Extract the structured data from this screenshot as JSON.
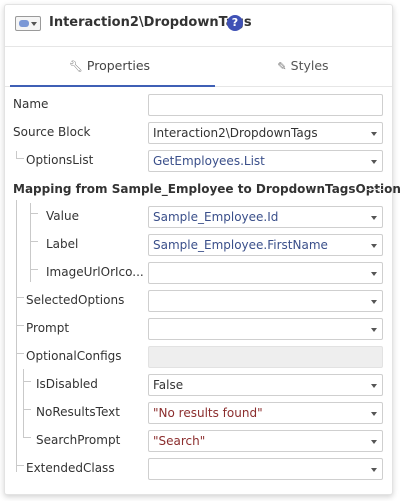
{
  "header": {
    "title": "Interaction2\\DropdownTags",
    "help_label": "?"
  },
  "tabs": [
    {
      "label": "Properties",
      "icon": "wrench-icon",
      "active": true
    },
    {
      "label": "Styles",
      "icon": "brush-icon",
      "active": false
    }
  ],
  "rows": {
    "name": {
      "label": "Name",
      "value": ""
    },
    "source_block": {
      "label": "Source Block",
      "value": "Interaction2\\DropdownTags"
    },
    "options_list": {
      "label": "OptionsList",
      "value": "GetEmployees.List"
    },
    "mapping_title": "Mapping from Sample_Employee to DropdownTagsOption",
    "value": {
      "label": "Value",
      "value": "Sample_Employee.Id"
    },
    "label": {
      "label": "Label",
      "value": "Sample_Employee.FirstName"
    },
    "image_url": {
      "label": "ImageUrlOrIco...",
      "value": ""
    },
    "selected_options": {
      "label": "SelectedOptions",
      "value": ""
    },
    "prompt": {
      "label": "Prompt",
      "value": ""
    },
    "optional_configs": {
      "label": "OptionalConfigs",
      "value": ""
    },
    "is_disabled": {
      "label": "IsDisabled",
      "value": "False"
    },
    "no_results_text": {
      "label": "NoResultsText",
      "value": "\"No results found\""
    },
    "search_prompt": {
      "label": "SearchPrompt",
      "value": "\"Search\""
    },
    "extended_class": {
      "label": "ExtendedClass",
      "value": ""
    }
  },
  "colors": {
    "accent": "#3f5fb5",
    "help_badge": "#3f51b5",
    "expression_text": "#3a4f8a",
    "string_text": "#8b2d2d"
  }
}
